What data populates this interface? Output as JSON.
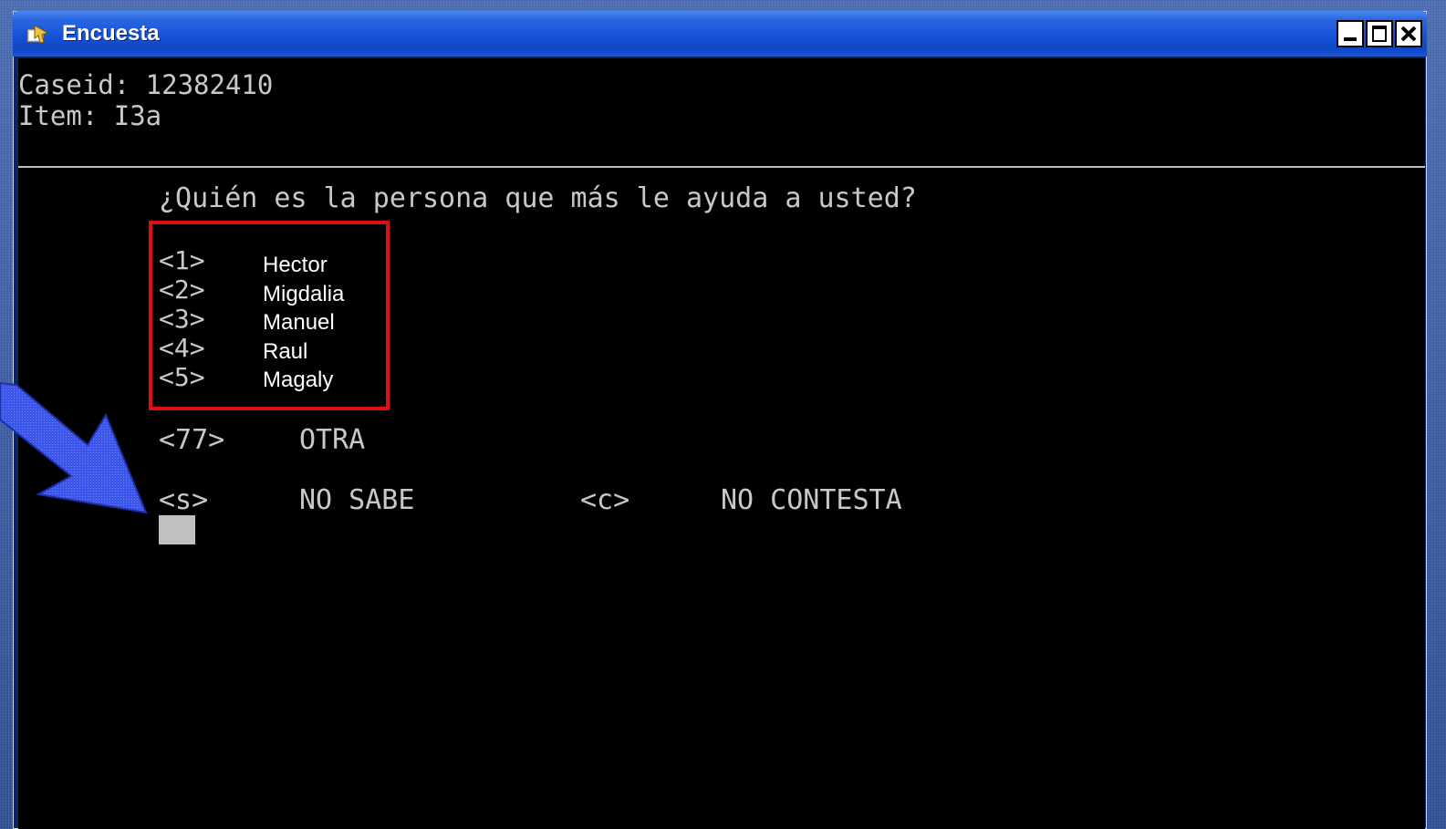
{
  "window": {
    "title": "Encuesta",
    "icon": "app-icon"
  },
  "header": {
    "caseid": "Caseid: 12382410",
    "item": "Item: I3a"
  },
  "question": "¿Quién es la persona que más le ayuda a usted?",
  "options": [
    {
      "code": "<1>",
      "name": "Hector"
    },
    {
      "code": "<2>",
      "name": "Migdalia"
    },
    {
      "code": "<3>",
      "name": "Manuel"
    },
    {
      "code": "<4>",
      "name": "Raul"
    },
    {
      "code": "<5>",
      "name": "Magaly"
    }
  ],
  "other": {
    "code": "<77>",
    "label": "OTRA"
  },
  "dont_know": {
    "code": "<s>",
    "label": "NO SABE"
  },
  "no_answer": {
    "code": "<c>",
    "label": "NO CONTESTA"
  },
  "colors": {
    "highlight_box": "#e01010",
    "arrow": "#3355ee",
    "console_bg": "#000000",
    "console_text": "#c8c8c8"
  }
}
